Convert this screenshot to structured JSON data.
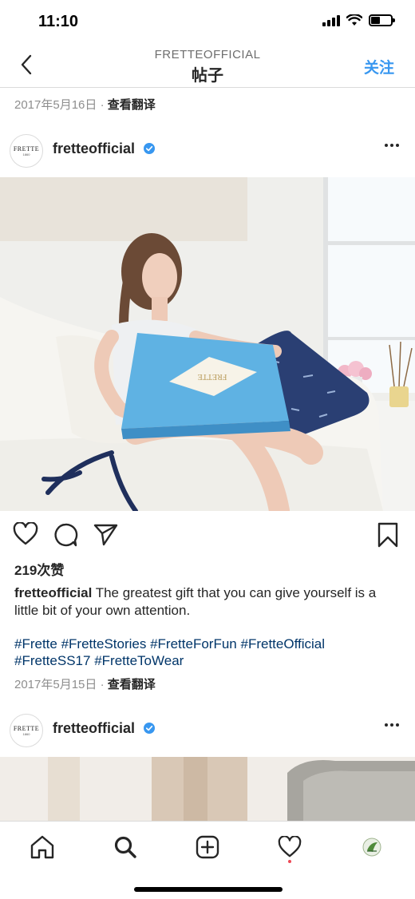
{
  "status_bar": {
    "time": "11:10"
  },
  "nav": {
    "account_label": "FRETTEOFFICIAL",
    "title": "帖子",
    "follow_label": "关注"
  },
  "prev_post_meta": {
    "date": "2017年5月16日",
    "separator": " · ",
    "translate": "查看翻译"
  },
  "post": {
    "avatar_text": "FRETTE",
    "avatar_sub": "1860",
    "username": "fretteofficial",
    "likes": "219次赞",
    "caption_user": "fretteofficial",
    "caption_text": " The greatest gift that you can give yourself is a little bit of your own attention.",
    "hashtags": [
      "#Frette",
      "#FretteStories",
      "#FretteForFun",
      "#FretteOfficial",
      "#FretteSS17",
      "#FretteToWear"
    ],
    "date": "2017年5月15日",
    "separator": " · ",
    "translate": "查看翻译",
    "box_logo_text": "FRETTE"
  },
  "next_post": {
    "avatar_text": "FRETTE",
    "avatar_sub": "1860",
    "username": "fretteofficial"
  },
  "icons": {
    "back": "chevron-left-icon",
    "more": "more-horizontal-icon",
    "verified": "verified-badge-icon",
    "like": "heart-icon",
    "comment": "comment-icon",
    "share": "send-icon",
    "save": "bookmark-icon",
    "home": "home-icon",
    "search": "search-icon",
    "add": "add-post-icon",
    "activity": "heart-icon",
    "profile": "profile-avatar-icon"
  },
  "colors": {
    "link_blue": "#3897f0",
    "hashtag": "#003569",
    "verified": "#3897f0",
    "notification_dot": "#ed4956"
  }
}
